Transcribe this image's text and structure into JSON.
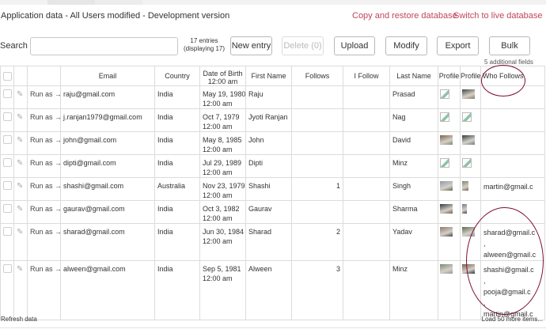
{
  "header": {
    "title": "Application data - All Users modified - Development version",
    "copy_restore_link": "Copy and restore database",
    "switch_live_link": "Switch to live database"
  },
  "toolbar": {
    "search_label": "Search",
    "search_value": "",
    "entries_line1": "17 entries",
    "entries_line2": "(displaying 17)",
    "new_entry": "New entry",
    "delete": "Delete (0)",
    "upload": "Upload",
    "modify": "Modify",
    "export": "Export",
    "bulk": "Bulk"
  },
  "additional_fields": "5 additional fields",
  "columns": [
    "Email",
    "Country",
    "Date of Birth",
    "First Name",
    "Follows",
    "I Follow",
    "Last Name",
    "Profile",
    "Profile",
    "Who Follows"
  ],
  "top_partial_time": "12:00 am",
  "rows": [
    {
      "run_as": "Run as →",
      "email": "raju@gmail.com",
      "country": "India",
      "dob": "May 19, 1980",
      "time": "12:00 am",
      "first_name": "Raju",
      "follows": "",
      "i_follow": "",
      "last_name": "Prasad",
      "p1": "broken",
      "p2": "photo",
      "who_follows": []
    },
    {
      "run_as": "Run as →",
      "email": "j.ranjan1979@gmail.com",
      "country": "India",
      "dob": "Oct 7, 1979",
      "time": "12:00 am",
      "first_name": "Jyoti Ranjan",
      "follows": "",
      "i_follow": "",
      "last_name": "Nag",
      "p1": "broken",
      "p2": "broken",
      "who_follows": []
    },
    {
      "run_as": "Run as →",
      "email": "john@gmail.com",
      "country": "India",
      "dob": "May 8, 1985",
      "time": "12:00 am",
      "first_name": "John",
      "follows": "",
      "i_follow": "",
      "last_name": "David",
      "p1": "photo",
      "p2": "photo",
      "who_follows": []
    },
    {
      "run_as": "Run as →",
      "email": "dipti@gmail.com",
      "country": "India",
      "dob": "Jul 29, 1989",
      "time": "12:00 am",
      "first_name": "Dipti",
      "follows": "",
      "i_follow": "",
      "last_name": "Minz",
      "p1": "broken",
      "p2": "broken",
      "who_follows": []
    },
    {
      "run_as": "Run as →",
      "email": "shashi@gmail.com",
      "country": "Australia",
      "dob": "Nov 23, 1979",
      "time": "12:00 am",
      "first_name": "Shashi",
      "follows": "1",
      "i_follow": "",
      "last_name": "Singh",
      "p1": "photo",
      "p2": "photo",
      "who_follows": [
        "martin@gmail.c"
      ]
    },
    {
      "run_as": "Run as →",
      "email": "gaurav@gmail.com",
      "country": "India",
      "dob": "Oct 3, 1982",
      "time": "12:00 am",
      "first_name": "Gaurav",
      "follows": "",
      "i_follow": "",
      "last_name": "Sharma",
      "p1": "photo",
      "p2": "photo",
      "who_follows": []
    },
    {
      "run_as": "Run as →",
      "email": "sharad@gmail.com",
      "country": "India",
      "dob": "Jun 30, 1984",
      "time": "12:00 am",
      "first_name": "Sharad",
      "follows": "2",
      "i_follow": "",
      "last_name": "Yadav",
      "p1": "photo",
      "p2": "photo",
      "who_follows": [
        "sharad@gmail.c",
        ",",
        "alween@gmail.c"
      ]
    },
    {
      "run_as": "Run as →",
      "email": "alween@gmail.com",
      "country": "India",
      "dob": "Sep 5, 1981",
      "time": "12:00 am",
      "first_name": "Alween",
      "follows": "3",
      "i_follow": "",
      "last_name": "Minz",
      "p1": "photo",
      "p2": "photo",
      "who_follows": [
        "shashi@gmail.c",
        ",",
        "pooja@gmail.c",
        ",",
        "martin@gmail.c"
      ]
    }
  ],
  "footer": {
    "refresh": "Refresh data",
    "load_more": "Load 50 more items..."
  },
  "colors": {
    "link": "#c0455e",
    "annotation": "#7a1030",
    "border": "#dcdcdc"
  }
}
